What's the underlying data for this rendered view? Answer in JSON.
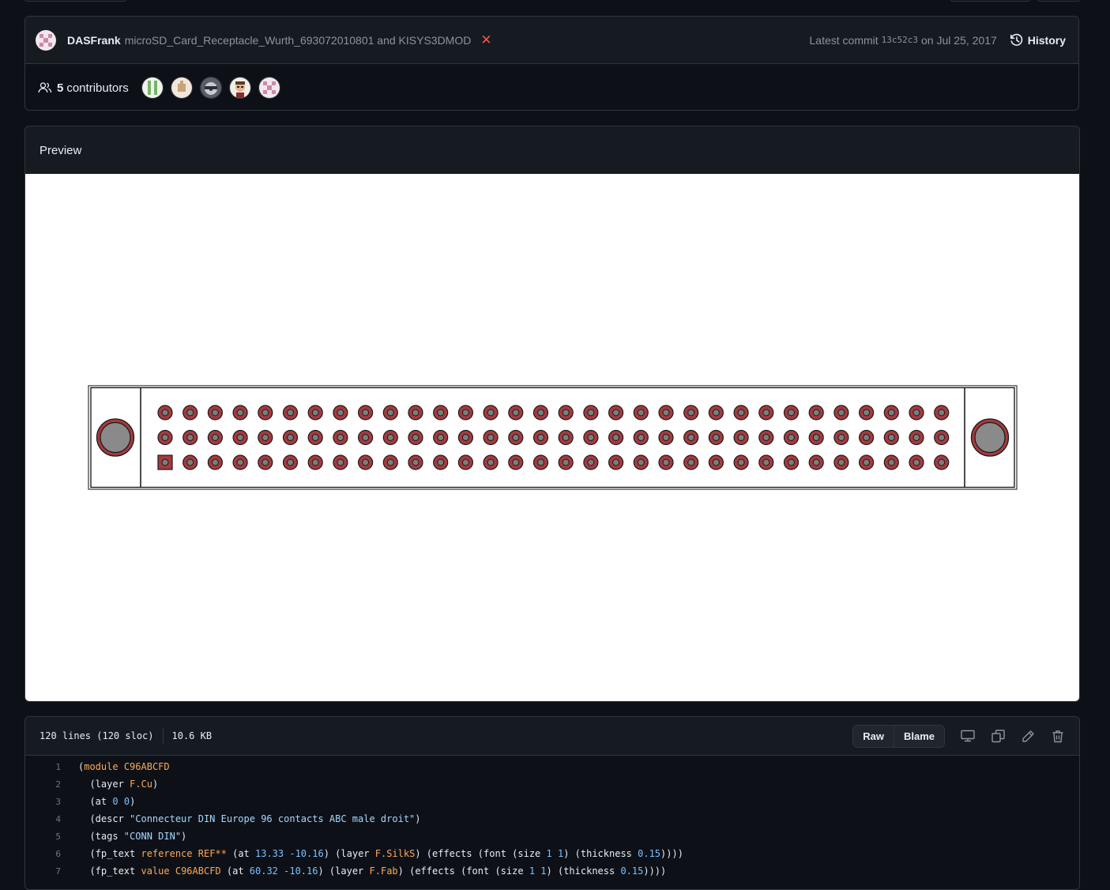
{
  "commit": {
    "author": "DASFrank",
    "message": "microSD_Card_Receptacle_Wurth_693072010801 and KISYS3DMOD",
    "status": "failure",
    "latest_label": "Latest commit",
    "sha": "13c52c3",
    "date_text": "on Jul 25, 2017",
    "history_label": "History"
  },
  "contributors": {
    "count": "5",
    "label": "contributors",
    "avatars": [
      "contributor-1",
      "contributor-2",
      "contributor-3",
      "contributor-4",
      "contributor-5"
    ]
  },
  "preview": {
    "label": "Preview"
  },
  "file_info": {
    "lines": "120 lines (120 sloc)",
    "size": "10.6 KB",
    "raw_label": "Raw",
    "blame_label": "Blame"
  },
  "code": [
    {
      "n": "1",
      "parts": [
        [
          "p",
          "("
        ],
        [
          "kw",
          "module"
        ],
        [
          "p",
          " "
        ],
        [
          "kw",
          "C96ABCFD"
        ]
      ]
    },
    {
      "n": "2",
      "parts": [
        [
          "p",
          "  (layer "
        ],
        [
          "kw",
          "F.Cu"
        ],
        [
          "p",
          ")"
        ]
      ]
    },
    {
      "n": "3",
      "parts": [
        [
          "p",
          "  (at "
        ],
        [
          "num",
          "0"
        ],
        [
          "p",
          " "
        ],
        [
          "num",
          "0"
        ],
        [
          "p",
          ")"
        ]
      ]
    },
    {
      "n": "4",
      "parts": [
        [
          "p",
          "  (descr "
        ],
        [
          "str",
          "\"Connecteur DIN Europe 96 contacts ABC male droit\""
        ],
        [
          "p",
          ")"
        ]
      ]
    },
    {
      "n": "5",
      "parts": [
        [
          "p",
          "  (tags "
        ],
        [
          "str",
          "\"CONN DIN\""
        ],
        [
          "p",
          ")"
        ]
      ]
    },
    {
      "n": "6",
      "parts": [
        [
          "p",
          "  (fp_text "
        ],
        [
          "kw",
          "reference"
        ],
        [
          "p",
          " "
        ],
        [
          "kw",
          "REF**"
        ],
        [
          "p",
          " (at "
        ],
        [
          "num",
          "13.33"
        ],
        [
          "p",
          " "
        ],
        [
          "num",
          "-10.16"
        ],
        [
          "p",
          ") (layer "
        ],
        [
          "kw",
          "F.SilkS"
        ],
        [
          "p",
          ") (effects (font (size "
        ],
        [
          "num",
          "1"
        ],
        [
          "p",
          " "
        ],
        [
          "num",
          "1"
        ],
        [
          "p",
          ") (thickness "
        ],
        [
          "num",
          "0.15"
        ],
        [
          "p",
          "))))"
        ]
      ]
    },
    {
      "n": "7",
      "parts": [
        [
          "p",
          "  (fp_text "
        ],
        [
          "kw",
          "value"
        ],
        [
          "p",
          " "
        ],
        [
          "kw",
          "C96ABCFD"
        ],
        [
          "p",
          " (at "
        ],
        [
          "num",
          "60.32"
        ],
        [
          "p",
          " "
        ],
        [
          "num",
          "-10.16"
        ],
        [
          "p",
          ") (layer "
        ],
        [
          "kw",
          "F.Fab"
        ],
        [
          "p",
          ") (effects (font (size "
        ],
        [
          "num",
          "1"
        ],
        [
          "p",
          " "
        ],
        [
          "num",
          "1"
        ],
        [
          "p",
          ") (thickness "
        ],
        [
          "num",
          "0.15"
        ],
        [
          "p",
          "))))"
        ]
      ]
    }
  ],
  "footprint": {
    "rows": 3,
    "pins_per_row": 32,
    "pad_color": "#a53a3e",
    "mount_color": "#8a8a8a",
    "first_pad_shape": "square"
  },
  "colors": {
    "background": "#0d1117",
    "header": "#161b22",
    "border": "#30363d",
    "muted": "#8b949e",
    "danger": "#f85149"
  }
}
